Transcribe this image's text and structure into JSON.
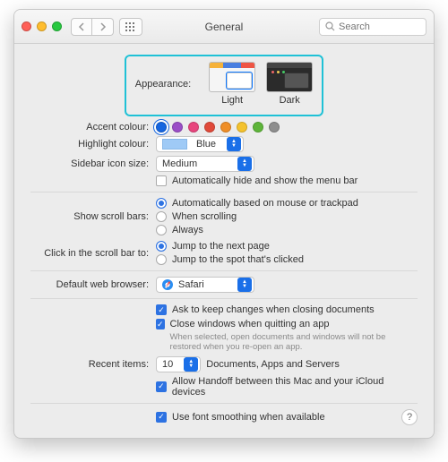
{
  "title": "General",
  "search": {
    "placeholder": "Search"
  },
  "appearance": {
    "label": "Appearance:",
    "light": "Light",
    "dark": "Dark"
  },
  "accent": {
    "label": "Accent colour:",
    "colors": [
      "#1666e0",
      "#9b4ec7",
      "#e8467e",
      "#e14a3a",
      "#ef8e27",
      "#f4c22d",
      "#5eb53a",
      "#8e8e8e"
    ],
    "active_index": 0
  },
  "highlight": {
    "label": "Highlight colour:",
    "value": "Blue"
  },
  "sidebar_size": {
    "label": "Sidebar icon size:",
    "value": "Medium"
  },
  "autohide_menu": {
    "checked": false,
    "label": "Automatically hide and show the menu bar"
  },
  "scroll": {
    "label": "Show scroll bars:",
    "opts": [
      "Automatically based on mouse or trackpad",
      "When scrolling",
      "Always"
    ],
    "selected": 0
  },
  "click_bar": {
    "label": "Click in the scroll bar to:",
    "opts": [
      "Jump to the next page",
      "Jump to the spot that's clicked"
    ],
    "selected": 0
  },
  "browser": {
    "label": "Default web browser:",
    "value": "Safari"
  },
  "ask_keep": {
    "checked": true,
    "label": "Ask to keep changes when closing documents"
  },
  "close_quit": {
    "checked": true,
    "label": "Close windows when quitting an app",
    "fine": "When selected, open documents and windows will not be restored when you re-open an app."
  },
  "recent": {
    "label": "Recent items:",
    "value": "10",
    "suffix": "Documents, Apps and Servers"
  },
  "handoff": {
    "checked": true,
    "label": "Allow Handoff between this Mac and your iCloud devices"
  },
  "font_smoothing": {
    "checked": true,
    "label": "Use font smoothing when available"
  }
}
